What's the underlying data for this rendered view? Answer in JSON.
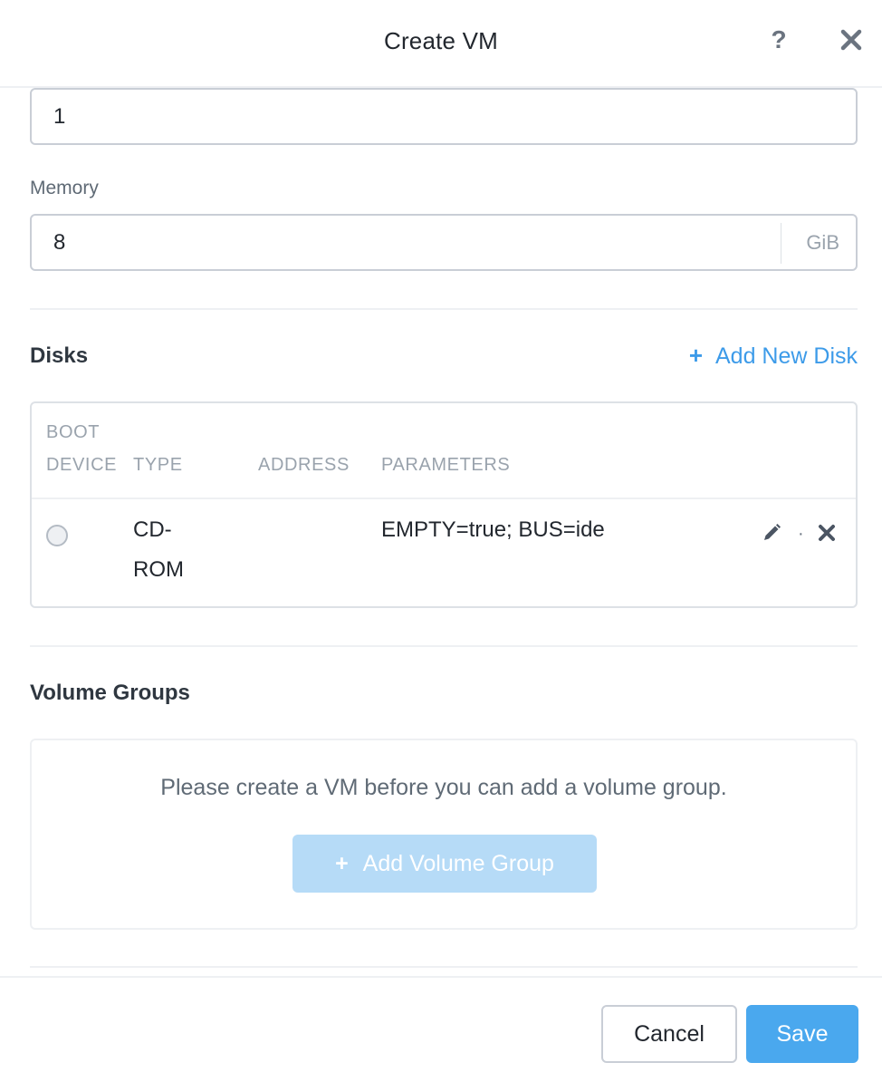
{
  "header": {
    "title": "Create VM",
    "help_label": "?"
  },
  "form": {
    "vcpu_value": "1",
    "memory_label": "Memory",
    "memory_value": "8",
    "memory_unit": "GiB"
  },
  "disks": {
    "title": "Disks",
    "add_label": "Add New Disk",
    "columns": {
      "boot_line1": "BOOT",
      "boot_line2": "DEVICE",
      "type": "TYPE",
      "address": "ADDRESS",
      "parameters": "PARAMETERS"
    },
    "rows": [
      {
        "boot_selected": false,
        "type_line1": "CD-",
        "type_line2": "ROM",
        "address": "",
        "parameters": "EMPTY=true; BUS=ide",
        "separator": "·"
      }
    ]
  },
  "volume_groups": {
    "title": "Volume Groups",
    "message": "Please create a VM before you can add a volume group.",
    "add_label": "Add Volume Group"
  },
  "footer": {
    "cancel_label": "Cancel",
    "save_label": "Save"
  },
  "colors": {
    "accent": "#4aa8ee",
    "link": "#3d9be9",
    "disabled_button": "#b6dbf7"
  },
  "icons": [
    "help-icon",
    "close-icon",
    "plus-icon",
    "edit-icon",
    "delete-icon"
  ]
}
